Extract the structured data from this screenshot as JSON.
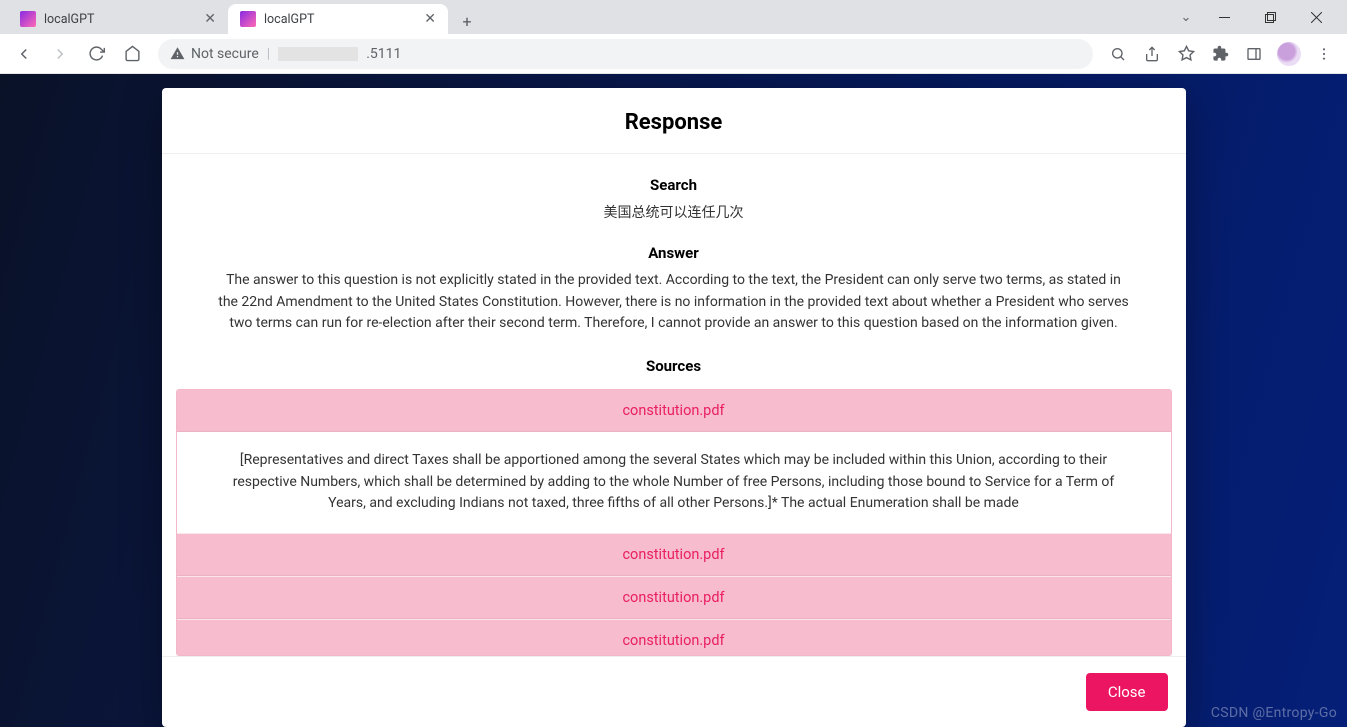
{
  "browser": {
    "tabs": [
      {
        "title": "localGPT",
        "active": false
      },
      {
        "title": "localGPT",
        "active": true
      }
    ],
    "omnibox": {
      "not_secure_label": "Not secure",
      "url_suffix": ".5111"
    }
  },
  "modal": {
    "header": "Response",
    "search_label": "Search",
    "search_text": "美国总统可以连任几次",
    "answer_label": "Answer",
    "answer_text": "The answer to this question is not explicitly stated in the provided text. According to the text, the President can only serve two terms, as stated in the 22nd Amendment to the United States Constitution. However, there is no information in the provided text about whether a President who serves two terms can run for re-election after their second term. Therefore, I cannot provide an answer to this question based on the information given.",
    "sources_label": "Sources",
    "sources": [
      {
        "file": "constitution.pdf",
        "expanded": true,
        "body": "[Representatives and direct Taxes shall be apportioned among the several States which may be included within this Union, according to their respective Numbers, which shall be determined by adding to the whole Number of free Persons, including those bound to Service for a Term of Years, and excluding Indians not taxed, three fifths of all other Persons.]* The actual Enumeration shall be made"
      },
      {
        "file": "constitution.pdf",
        "expanded": false
      },
      {
        "file": "constitution.pdf",
        "expanded": false
      },
      {
        "file": "constitution.pdf",
        "expanded": false
      }
    ],
    "close_label": "Close"
  },
  "watermark": "CSDN @Entropy-Go"
}
